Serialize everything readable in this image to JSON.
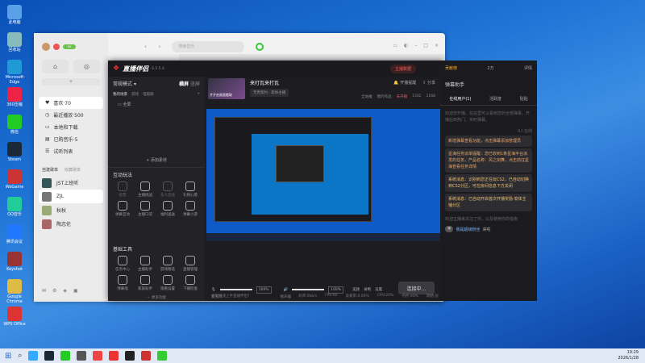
{
  "desktop_icons": [
    {
      "label": "此电脑",
      "color": "#5aa0e6"
    },
    {
      "label": "回收站",
      "color": "#8bb"
    },
    {
      "label": "Microsoft Edge",
      "color": "#1f9ad6"
    },
    {
      "label": "360压缩",
      "color": "#e24"
    },
    {
      "label": "微信",
      "color": "#2c2"
    },
    {
      "label": "Steam",
      "color": "#1b2838"
    },
    {
      "label": "WeGame",
      "color": "#c33"
    },
    {
      "label": "QQ音乐",
      "color": "#2c9"
    },
    {
      "label": "腾讯会议",
      "color": "#27f"
    },
    {
      "label": "Keyshot",
      "color": "#933"
    },
    {
      "label": "Google Chrome",
      "color": "#db4"
    },
    {
      "label": "WPS Office",
      "color": "#d33"
    }
  ],
  "music": {
    "user_level": "Lv",
    "search_placeholder": "搜索音乐",
    "nav": [
      {
        "label": "喜欢·70",
        "sel": true
      },
      {
        "label": "最近播放·500"
      },
      {
        "label": "本地和下载"
      },
      {
        "label": "已购音乐·5"
      },
      {
        "label": "试听列表"
      }
    ],
    "tabs": {
      "created": "自建歌单",
      "collected": "收藏歌单"
    },
    "playlists": [
      {
        "name": "JST上班听",
        "color": "#355"
      },
      {
        "name": "ZJL",
        "color": "#777"
      },
      {
        "name": "秋秋",
        "color": "#9a7"
      },
      {
        "name": "陶志伦",
        "color": "#a66"
      }
    ]
  },
  "stream": {
    "app_name": "直播伴侣",
    "version": "6.5.5.4",
    "mode": "常规模式",
    "tab_landscape": "横屏",
    "tab_portrait": "竖屏",
    "scene_tabs": [
      "我的场景",
      "游戏",
      "电脑端"
    ],
    "scene_item": "全屏",
    "add_material": "添加素材",
    "interactive_title": "互动玩法",
    "interactive": [
      {
        "label": "投票",
        "dim": true
      },
      {
        "label": "主播挑战",
        "dim": false
      },
      {
        "label": "多人连线",
        "dim": true
      },
      {
        "label": "礼物心愿",
        "dim": false
      },
      {
        "label": "弹幕互动",
        "dim": false
      },
      {
        "label": "主播口袋",
        "dim": false
      },
      {
        "label": "福利送送",
        "dim": false
      },
      {
        "label": "弹幕小游",
        "dim": false
      }
    ],
    "tools_title": "基础工具",
    "tools": [
      {
        "label": "任务中心"
      },
      {
        "label": "主播助手"
      },
      {
        "label": "游戏精选"
      },
      {
        "label": "直播管理"
      },
      {
        "label": "弹幕墙"
      },
      {
        "label": "家族助手"
      },
      {
        "label": "观看设置"
      },
      {
        "label": "下播检查"
      }
    ],
    "more": "更多功能",
    "title": "来打瓦来打瓦",
    "subtitle": "无畏契约 · 软体主播",
    "cover_label": "开开启画面截取",
    "top_actions": [
      "开播提醒",
      "分享"
    ],
    "top_right": "主播数据",
    "stats": [
      "全站推",
      "我的作品",
      "未开播",
      "1332",
      "1168"
    ],
    "controls": {
      "mic": "麦克风",
      "mic_vol": "100%",
      "speaker": "扬声器",
      "spk_vol": "100%",
      "beauty": "美颜",
      "record": "录制",
      "settings": "设置"
    },
    "start_btn": "连接中...",
    "status": [
      "如何快速上手直播伴侣？",
      "码率:0kb/s",
      "FPS:60",
      "丢帧率:0.00%",
      "CPU:20%",
      "内存:40%",
      "网络:良"
    ]
  },
  "right": {
    "top": [
      "贡献榜",
      "2万",
      "评情"
    ],
    "title": "弹幕助手",
    "tabs": [
      "在线用户(1)",
      "活跃度",
      "贴贴"
    ],
    "empty": "欢迎您开播，在这里可以看到您的全部弹幕，开播后到热门、实时弹幕。",
    "count": "0人在线",
    "messages": [
      {
        "text": "新增弹幕查看功能，点击弹幕添加管理员",
        "sys": false
      },
      {
        "text": "星海任务派单提醒：您已收到1条星海平台派发的任务，产品名称：风之剑舞，点击前往星海查看任务详情",
        "sys": false
      },
      {
        "text": "系统消息：识别到您正在玩CS2，已自动切换到CS2分区，可在房间信息下方关闭",
        "sys": true
      },
      {
        "text": "系统消息：已自动开启首次开播奖励·软体主播分区",
        "sys": true
      }
    ],
    "footer": "欢迎主播来关注了你，以及使用你的指南",
    "fan_label": "我是超级粉丝",
    "fan_status": "来啦"
  },
  "taskbar": {
    "time": "19:29",
    "date": "2026/1/28"
  }
}
